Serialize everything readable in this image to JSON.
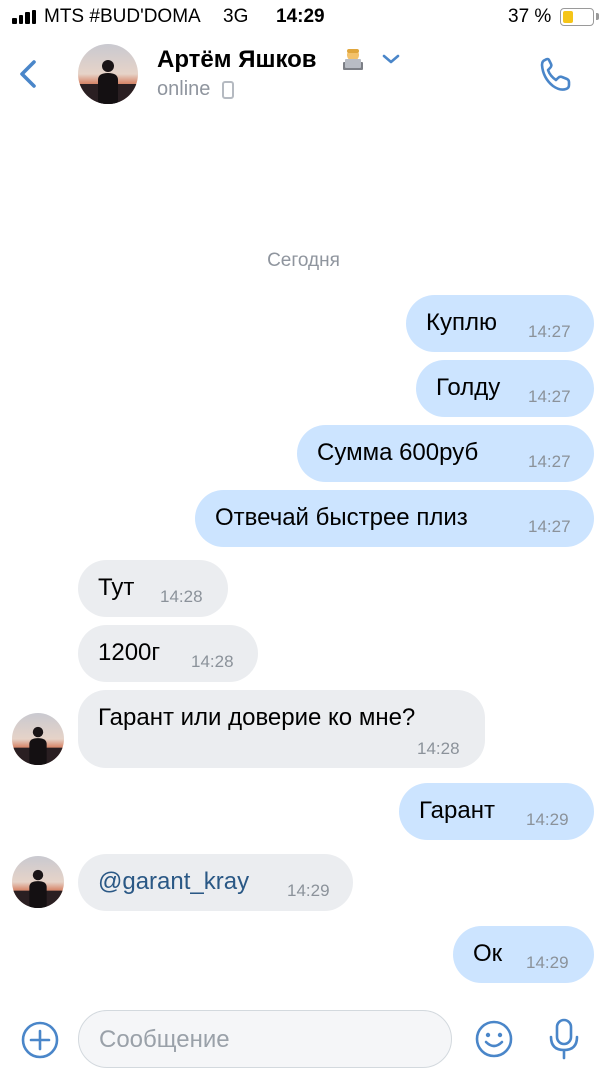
{
  "status_bar": {
    "carrier": "MTS #BUD'DOMA",
    "network": "3G",
    "time": "14:29",
    "battery": "37 %",
    "battery_level": 0.37
  },
  "header": {
    "back_icon": "chevron-left-icon",
    "contact_name": "Артём Яшков",
    "name_emoji": "technologist-emoji",
    "status": "online",
    "status_icon": "mobile-phone-icon",
    "call_icon": "phone-icon"
  },
  "chat": {
    "date_separator": "Сегодня",
    "messages": [
      {
        "dir": "out",
        "text": "Куплю",
        "time": "14:27"
      },
      {
        "dir": "out",
        "text": "Голду",
        "time": "14:27"
      },
      {
        "dir": "out",
        "text": "Сумма 600руб",
        "time": "14:27"
      },
      {
        "dir": "out",
        "text": "Отвечай быстрее плиз",
        "time": "14:27"
      },
      {
        "dir": "in",
        "text": "Тут",
        "time": "14:28"
      },
      {
        "dir": "in",
        "text": "1200г",
        "time": "14:28"
      },
      {
        "dir": "in",
        "text": "Гарант или доверие ко мне?",
        "time": "14:28"
      },
      {
        "dir": "out",
        "text": "Гарант",
        "time": "14:29"
      },
      {
        "dir": "in",
        "text": "@garant_kray",
        "time": "14:29"
      },
      {
        "dir": "out",
        "text": "Ок",
        "time": "14:29"
      }
    ]
  },
  "input_bar": {
    "placeholder": "Сообщение",
    "attach_icon": "plus-circle-icon",
    "emoji_icon": "smile-icon",
    "voice_icon": "microphone-icon"
  },
  "colors": {
    "accent": "#4a86c9",
    "outgoing_bubble": "#cce4ff",
    "incoming_bubble": "#ebedf0",
    "link": "#2a5885"
  }
}
